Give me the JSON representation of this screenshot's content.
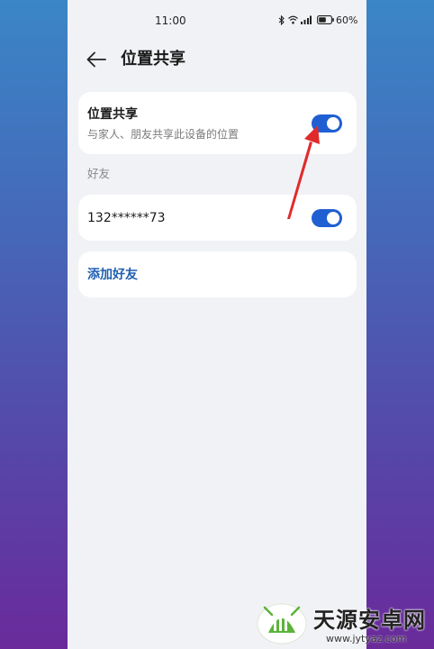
{
  "status_bar": {
    "time": "11:00",
    "battery": "60%",
    "icons": [
      "bluetooth-icon",
      "wifi-icon",
      "signal-icon",
      "battery-icon"
    ]
  },
  "header": {
    "back_icon": "arrow-left-icon",
    "title": "位置共享"
  },
  "location_sharing": {
    "title": "位置共享",
    "subtitle": "与家人、朋友共享此设备的位置",
    "enabled": true
  },
  "friends": {
    "section_label": "好友",
    "items": [
      {
        "phone": "132******73",
        "enabled": true
      }
    ],
    "add_label": "添加好友"
  },
  "watermark": {
    "name": "天源安卓网",
    "url": "www.jytyaz.com"
  },
  "colors": {
    "accent": "#1f5fd2",
    "link": "#1f5fb0",
    "annotation_arrow": "#e02a2a",
    "screen_bg": "#f1f2f6",
    "card_bg": "#ffffff"
  }
}
